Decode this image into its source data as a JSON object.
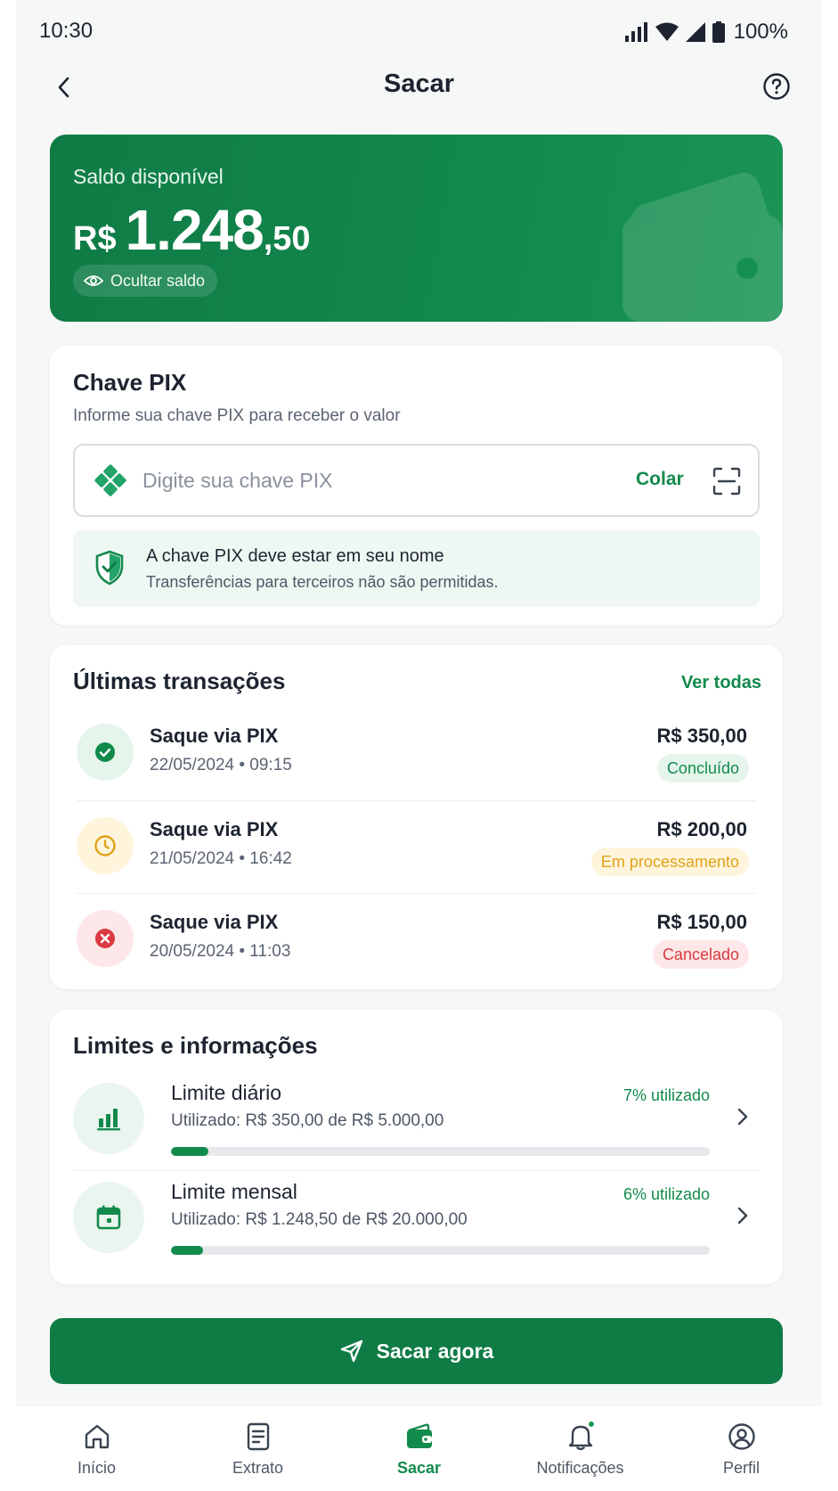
{
  "status_bar": {
    "time": "10:30",
    "battery": "100%"
  },
  "header": {
    "title": "Sacar"
  },
  "balance": {
    "label": "Saldo disponível",
    "currency": "R$",
    "integer": "1.248",
    "cents": ",50",
    "hide_label": "Ocultar saldo"
  },
  "pix": {
    "title": "Chave PIX",
    "subtitle": "Informe sua chave PIX para receber o valor",
    "placeholder": "Digite sua chave PIX",
    "paste_label": "Colar",
    "note_title": "A chave PIX deve estar em seu nome",
    "note_text": "Transferências para terceiros não são permitidas."
  },
  "transactions": {
    "title": "Últimas transações",
    "see_all": "Ver todas",
    "items": [
      {
        "name": "Saque via PIX",
        "date": "22/05/2024 • 09:15",
        "amount": "R$ 350,00",
        "status": "Concluído",
        "status_type": "success"
      },
      {
        "name": "Saque via PIX",
        "date": "21/05/2024 • 16:42",
        "amount": "R$ 200,00",
        "status": "Em processamento",
        "status_type": "pending"
      },
      {
        "name": "Saque via PIX",
        "date": "20/05/2024 • 11:03",
        "amount": "R$ 150,00",
        "status": "Cancelado",
        "status_type": "cancelled"
      }
    ]
  },
  "limits": {
    "title": "Limites e informações",
    "items": [
      {
        "name": "Limite diário",
        "used": "Utilizado: R$ 350,00 de R$ 5.000,00",
        "percent_label": "7% utilizado",
        "percent": 7
      },
      {
        "name": "Limite mensal",
        "used": "Utilizado: R$ 1.248,50 de R$ 20.000,00",
        "percent_label": "6% utilizado",
        "percent": 6
      }
    ]
  },
  "cta": {
    "label": "Sacar agora"
  },
  "nav": {
    "items": [
      {
        "label": "Início",
        "icon": "home-icon"
      },
      {
        "label": "Extrato",
        "icon": "statement-icon"
      },
      {
        "label": "Sacar",
        "icon": "wallet-icon",
        "active": true
      },
      {
        "label": "Notificações",
        "icon": "bell-icon"
      },
      {
        "label": "Perfil",
        "icon": "profile-icon"
      }
    ]
  },
  "colors": {
    "primary": "#0f7b45",
    "accent": "#128a4c",
    "success_bg": "#e6f5ec",
    "pending": "#e0a21a",
    "pending_bg": "#fff5dc",
    "danger": "#d93a40",
    "danger_bg": "#fde7e8"
  }
}
